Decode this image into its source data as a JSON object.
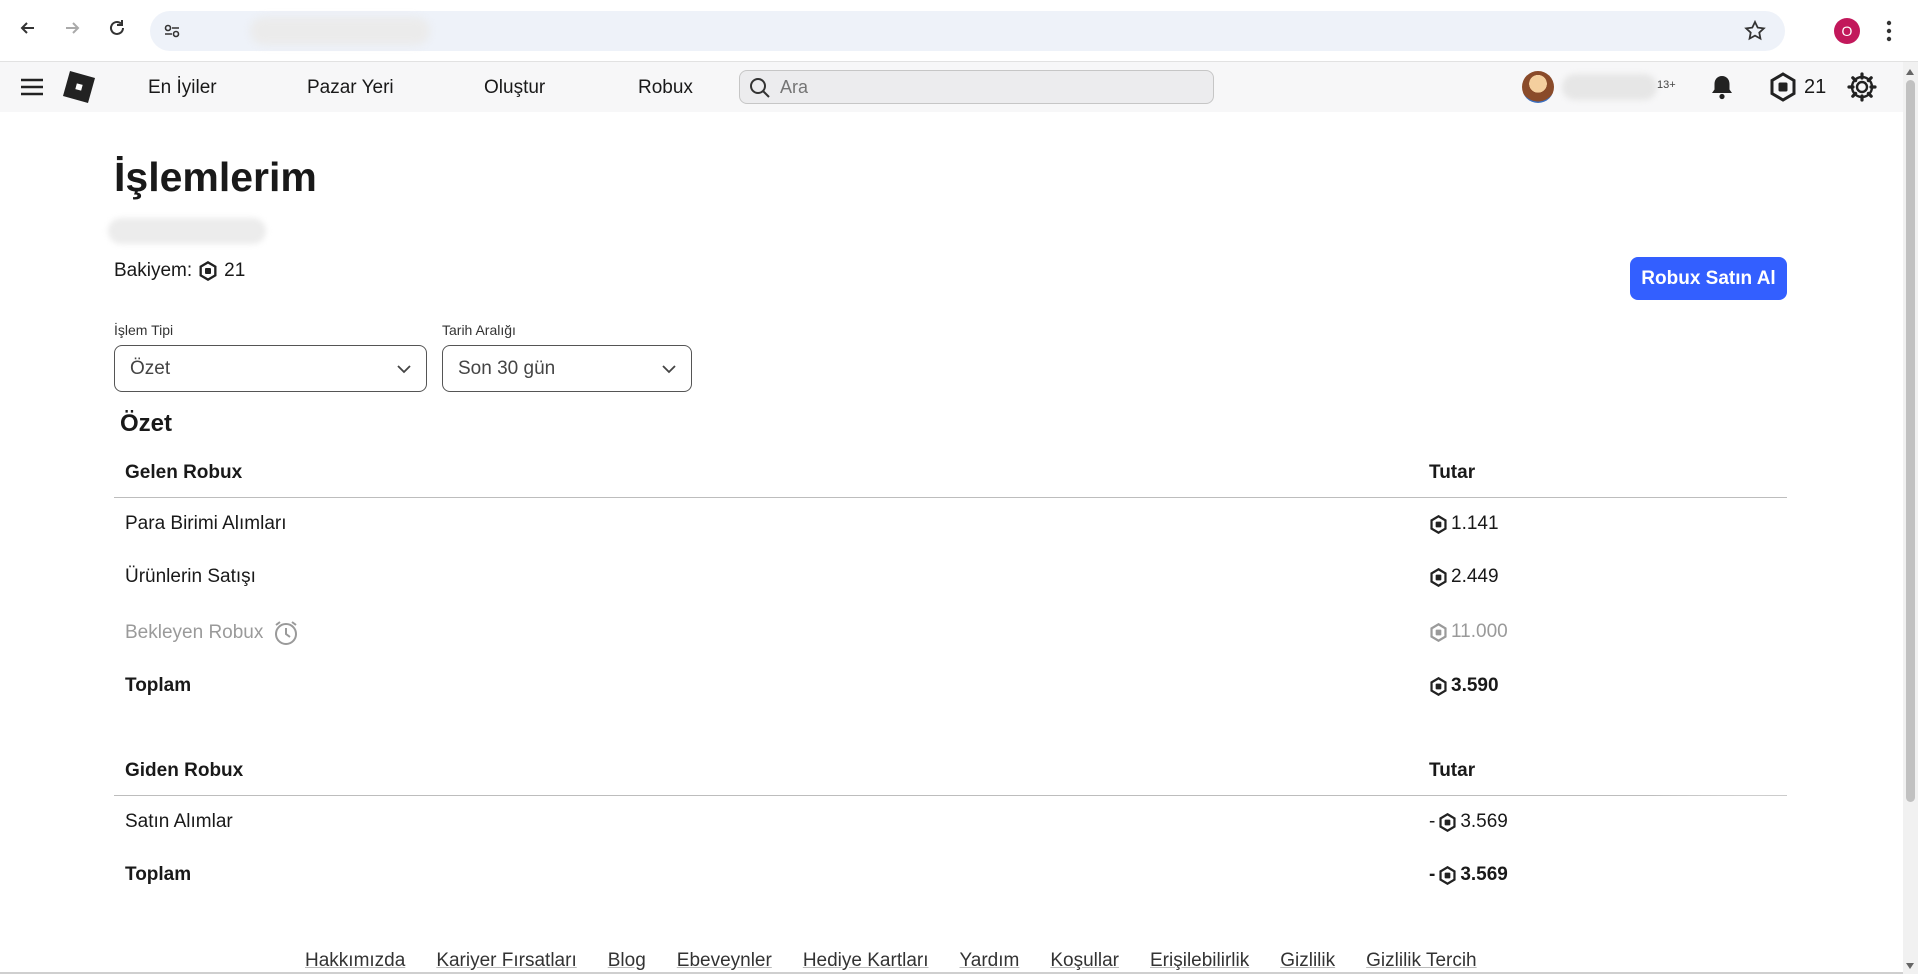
{
  "browser": {
    "url": "",
    "profile_initial": "O"
  },
  "header": {
    "nav": [
      "En İyiler",
      "Pazar Yeri",
      "Oluştur",
      "Robux"
    ],
    "search_placeholder": "Ara",
    "age_badge": "13+",
    "robux_balance": "21"
  },
  "page": {
    "title": "İşlemlerim",
    "balance_label": "Bakiyem:",
    "balance_value": "21",
    "buy_button": "Robux Satın Al",
    "filters": {
      "type_label": "İşlem Tipi",
      "type_value": "Özet",
      "date_label": "Tarih Aralığı",
      "date_value": "Son 30 gün"
    },
    "section_title": "Özet"
  },
  "incoming": {
    "header": "Gelen Robux",
    "amount_header": "Tutar",
    "rows": [
      {
        "label": "Para Birimi Alımları",
        "amount": "1.141"
      },
      {
        "label": "Ürünlerin Satışı",
        "amount": "2.449"
      },
      {
        "label": "Bekleyen Robux",
        "amount": "11.000"
      },
      {
        "label": "Toplam",
        "amount": "3.590"
      }
    ]
  },
  "outgoing": {
    "header": "Giden Robux",
    "amount_header": "Tutar",
    "rows": [
      {
        "label": "Satın Alımlar",
        "prefix": "-",
        "amount": "3.569"
      },
      {
        "label": "Toplam",
        "prefix": "-",
        "amount": "3.569"
      }
    ]
  },
  "footer": {
    "links": [
      "Hakkımızda",
      "Kariyer Fırsatları",
      "Blog",
      "Ebeveynler",
      "Hediye Kartları",
      "Yardım",
      "Koşullar",
      "Erişilebilirlik",
      "Gizlilik",
      "Gizlilik Tercih"
    ]
  },
  "colors": {
    "accent": "#335fff",
    "pending_text": "#9a9a9a",
    "profile": "#c2185b"
  }
}
